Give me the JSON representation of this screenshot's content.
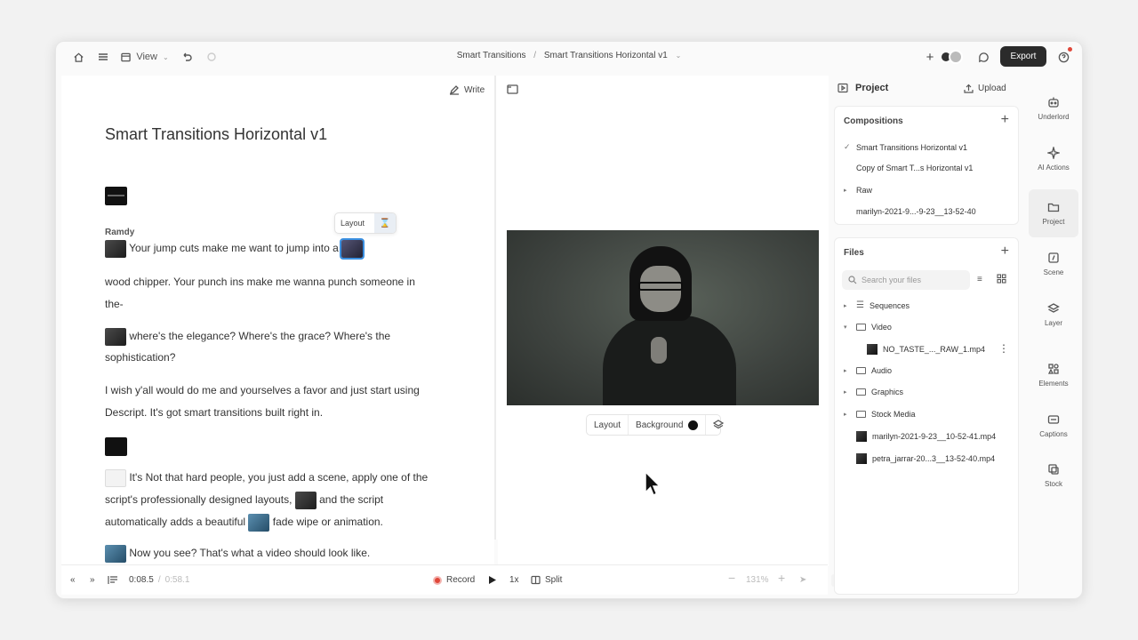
{
  "topbar": {
    "view_label": "View",
    "breadcrumb_project": "Smart Transitions",
    "breadcrumb_sep": "/",
    "breadcrumb_comp": "Smart Transitions Horizontal v1",
    "export_label": "Export"
  },
  "script": {
    "write_label": "Write",
    "title": "Smart Transitions Horizontal v1",
    "speaker": "Ramdy",
    "layout_popover": "Layout",
    "lines": [
      "Your jump cuts make me want to jump into a",
      "wood chipper. Your punch ins make me wanna punch someone in",
      "the-",
      "where's the elegance? Where's the grace? Where's the",
      "sophistication?",
      "I wish y'all would do me and yourselves a favor and just start using",
      "Descript. It's got smart transitions built right in.",
      "It's Not that hard people, you just add a scene, apply one of the",
      "script's professionally designed layouts,",
      "and the script",
      "automatically adds a beautiful",
      "fade wipe or animation.",
      "Now you see? That's what a video should look like."
    ]
  },
  "video_toolbar": {
    "layout_label": "Layout",
    "background_label": "Background"
  },
  "transport": {
    "current_time": "0:08.5",
    "time_sep": "/",
    "total_time": "0:58.1",
    "record_label": "Record",
    "speed_label": "1x",
    "split_label": "Split",
    "zoom_label": "131%"
  },
  "project": {
    "title": "Project",
    "upload_label": "Upload",
    "compositions_title": "Compositions",
    "compositions": [
      "Smart Transitions Horizontal v1",
      "Copy of Smart T...s Horizontal v1",
      "Raw",
      "marilyn-2021-9...-9-23__13-52-40"
    ],
    "files_title": "Files",
    "search_placeholder": "Search your files",
    "files": [
      "Sequences",
      "Video",
      "NO_TASTE_..._RAW_1.mp4",
      "Audio",
      "Graphics",
      "Stock Media",
      "marilyn-2021-9-23__10-52-41.mp4",
      "petra_jarrar-20...3__13-52-40.mp4"
    ]
  },
  "rail": {
    "items": [
      "Underlord",
      "AI Actions",
      "Project",
      "Scene",
      "Layer",
      "Elements",
      "Captions",
      "Stock"
    ]
  }
}
